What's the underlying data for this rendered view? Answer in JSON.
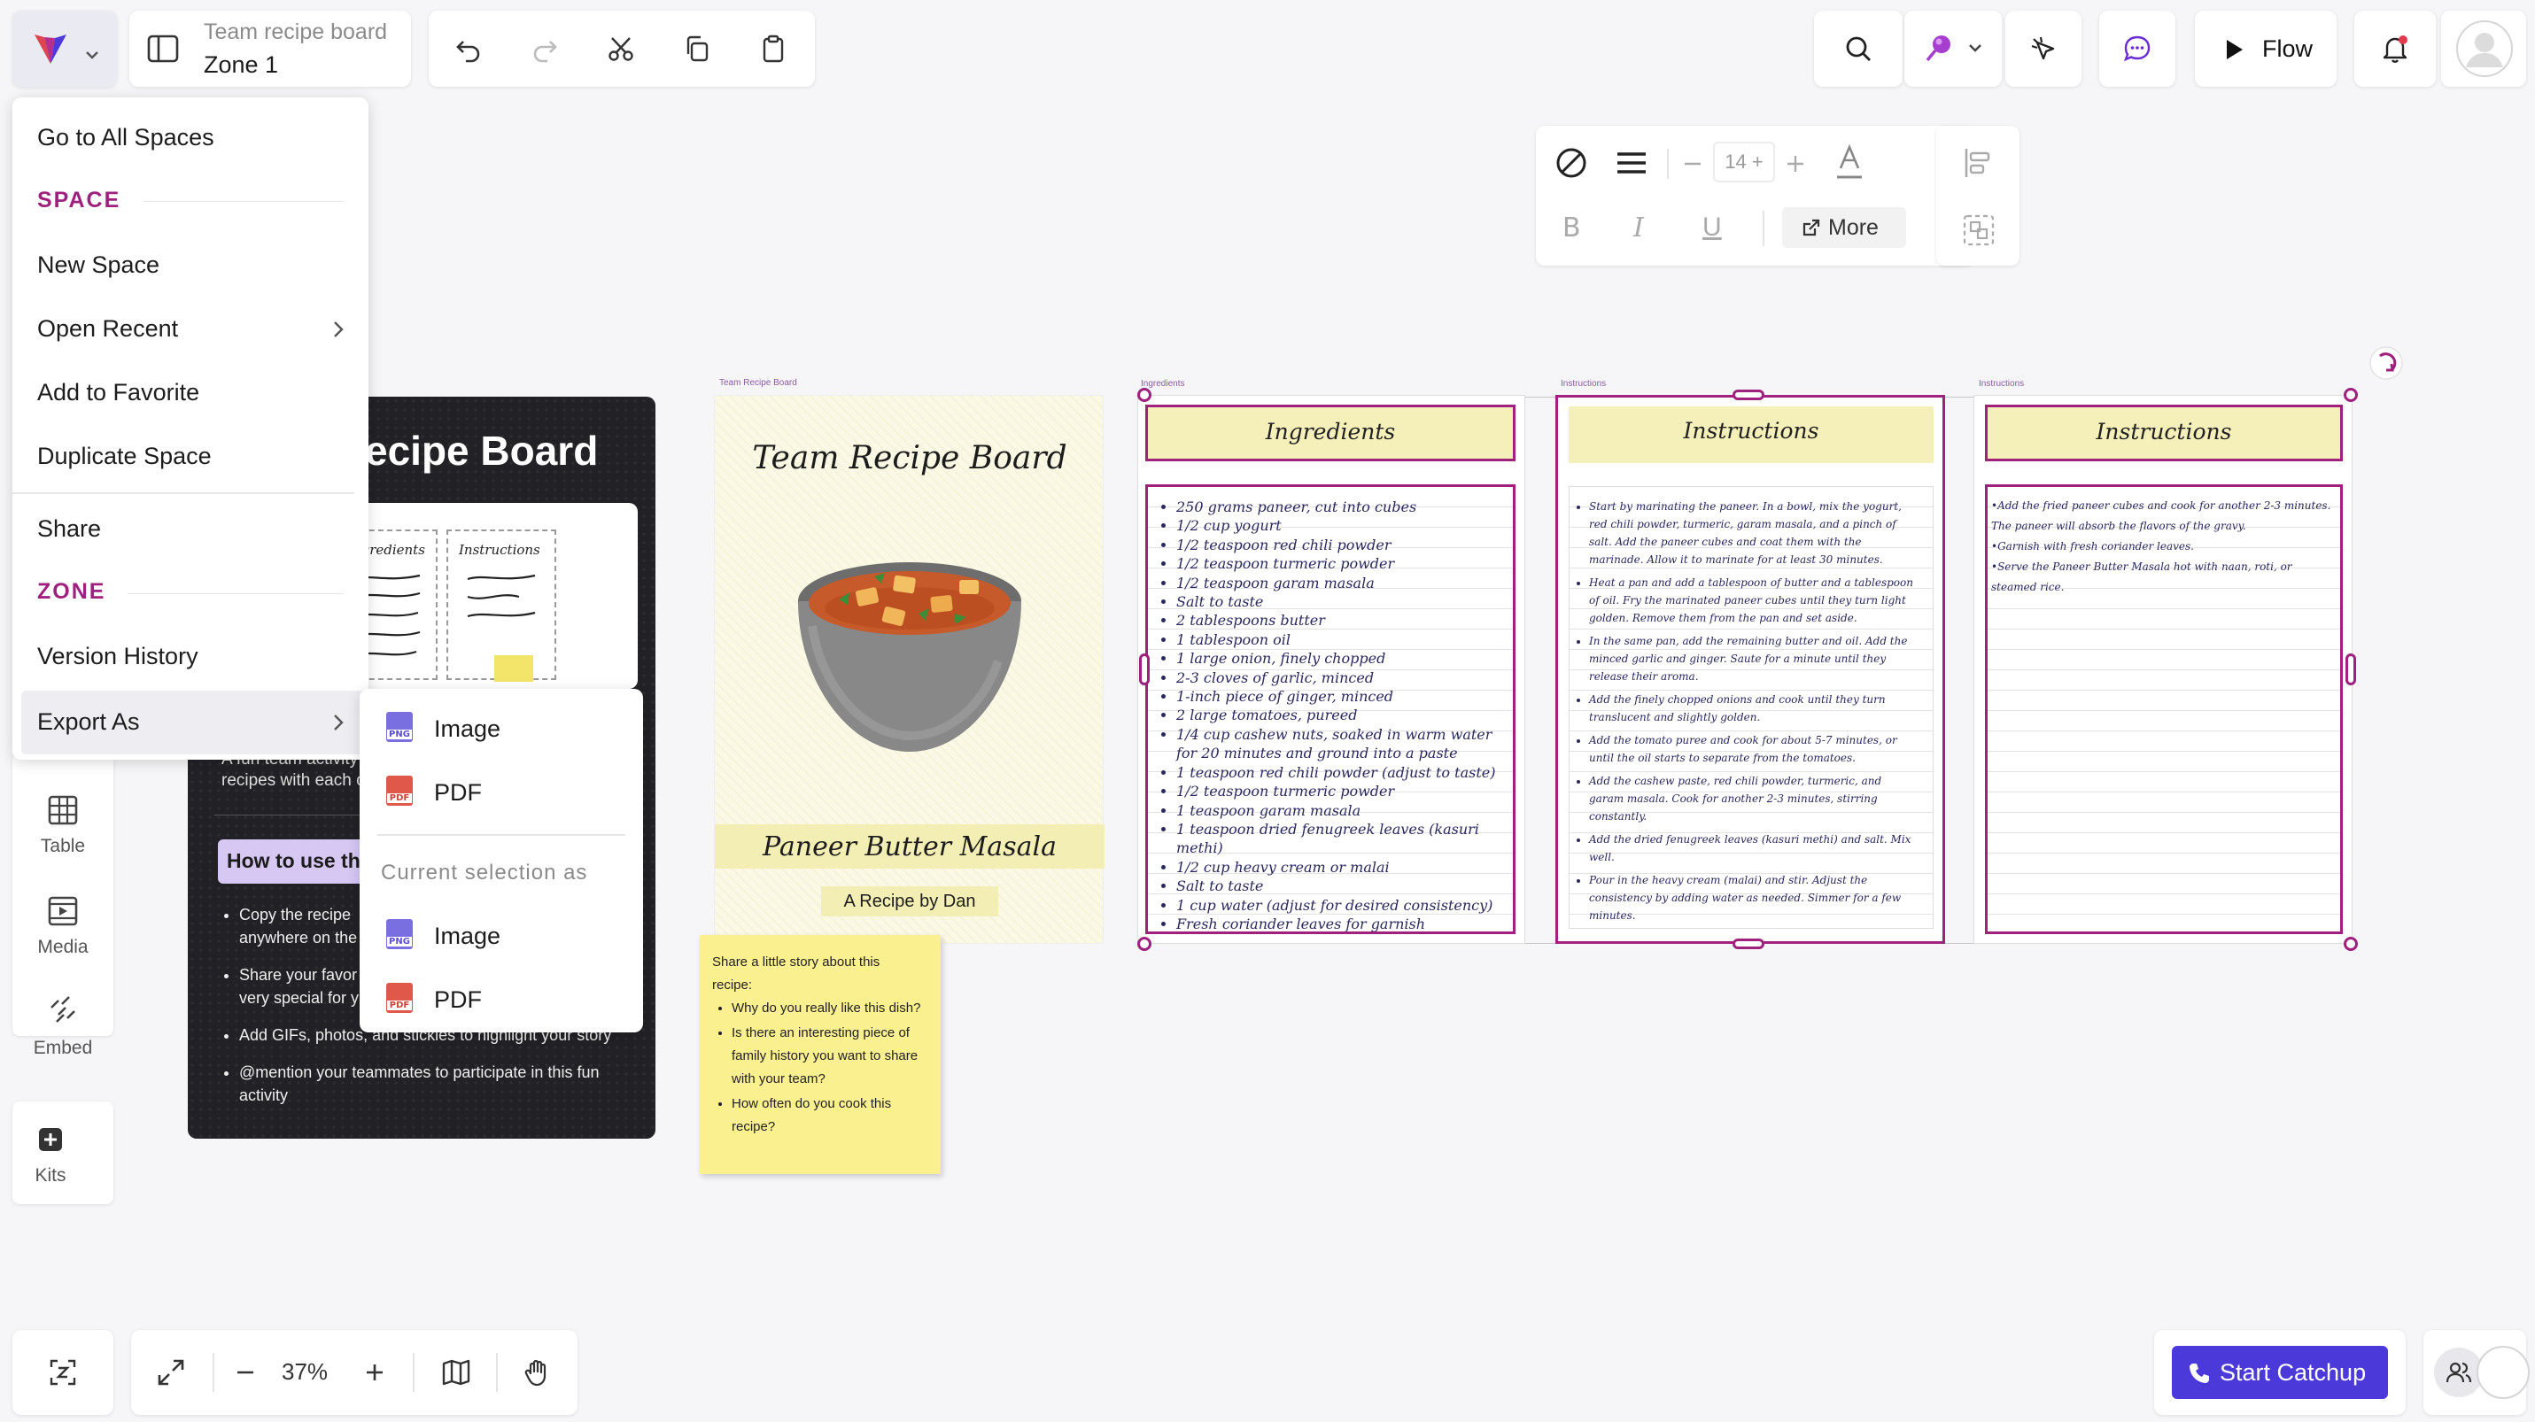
{
  "header": {
    "board_title": "Team recipe board",
    "zone_name": "Zone 1",
    "flow_label": "Flow"
  },
  "menu": {
    "go_to_all": "Go to All Spaces",
    "space_heading": "SPACE",
    "new_space": "New Space",
    "open_recent": "Open Recent",
    "add_favorite": "Add to Favorite",
    "duplicate_space": "Duplicate Space",
    "share": "Share",
    "zone_heading": "ZONE",
    "version_history": "Version History",
    "export_as": "Export As"
  },
  "export_submenu": {
    "image": "Image",
    "pdf": "PDF",
    "current_selection_heading": "Current selection as",
    "selection_image": "Image",
    "selection_pdf": "PDF",
    "png_badge": "PNG",
    "pdf_badge": "PDF"
  },
  "format_toolbar": {
    "font_size": "14",
    "more_label": "More",
    "bold": "B",
    "italic": "I",
    "underline": "U"
  },
  "tools": {
    "table": "Table",
    "media": "Media",
    "embed": "Embed",
    "kits": "Kits"
  },
  "bottom_bar": {
    "zoom_level": "37%",
    "start_catchup": "Start Catchup"
  },
  "dark_card": {
    "title": "ecipe Board",
    "ingredients_thumb": "Ingredients",
    "instructions_thumb": "Instructions",
    "desc_line1": "A fun team activity",
    "desc_line2": "recipes with each o",
    "how_to_title": "How to use th",
    "bullets": [
      "Copy the recipe anywhere on the",
      "Share your favor very special for y",
      "Add GIFs, photos, and stickies to highlight your story",
      "@mention your teammates to participate in this fun activity"
    ]
  },
  "recipe_card": {
    "frame_label": "Team Recipe Board",
    "title": "Team Recipe Board",
    "dish": "Paneer Butter Masala",
    "author": "A Recipe by Dan"
  },
  "sticky": {
    "intro": "Share a little story about this recipe:",
    "questions": [
      "Why do you really like this dish?",
      "Is there an interesting piece of family history you want to share with your team?",
      "How often do you cook this recipe?"
    ]
  },
  "ingredients_panel": {
    "frame_label": "Ingredients",
    "title": "Ingredients",
    "items": [
      "250 grams paneer, cut into cubes",
      "1/2 cup yogurt",
      "1/2 teaspoon red chili powder",
      "1/2 teaspoon turmeric powder",
      "1/2 teaspoon garam masala",
      "Salt to taste",
      "2 tablespoons butter",
      "1 tablespoon oil",
      "1 large onion, finely chopped",
      "2-3 cloves of garlic, minced",
      "1-inch piece of ginger, minced",
      "2 large tomatoes, pureed",
      "1/4 cup cashew nuts, soaked in warm water for 20 minutes and ground into a paste",
      "1 teaspoon red chili powder (adjust to taste)",
      "1/2 teaspoon turmeric powder",
      "1 teaspoon garam masala",
      "1 teaspoon dried fenugreek leaves (kasuri methi)",
      "1/2 cup heavy cream or malai",
      "Salt to taste",
      "1 cup water (adjust for desired consistency)",
      "Fresh coriander leaves for garnish"
    ]
  },
  "instructions_panel_1": {
    "frame_label": "Instructions",
    "title": "Instructions",
    "steps": [
      "Start by marinating the paneer. In a bowl, mix the yogurt, red chili powder, turmeric, garam masala, and a pinch of salt. Add the paneer cubes and coat them with the marinade. Allow it to marinate for at least 30 minutes.",
      "Heat a pan and add a tablespoon of butter and a tablespoon of oil. Fry the marinated paneer cubes until they turn light golden. Remove them from the pan and set aside.",
      "In the same pan, add the remaining butter and oil. Add the minced garlic and ginger. Saute for a minute until they release their aroma.",
      "Add the finely chopped onions and cook until they turn translucent and slightly golden.",
      "Add the tomato puree and cook for about 5-7 minutes, or until the oil starts to separate from the tomatoes.",
      "Add the cashew paste, red chili powder, turmeric, and garam masala. Cook for another 2-3 minutes, stirring constantly.",
      "Add the dried fenugreek leaves (kasuri methi) and salt. Mix well.",
      "Pour in the heavy cream (malai) and stir. Adjust the consistency by adding water as needed. Simmer for a few minutes."
    ]
  },
  "instructions_panel_2": {
    "frame_label": "Instructions",
    "title": "Instructions",
    "steps": [
      "•Add the fried paneer cubes and cook for another 2-3 minutes. The paneer will absorb the flavors of the gravy.",
      "•Garnish with fresh coriander leaves.",
      "•Serve the Paneer Butter Masala hot with naan, roti, or steamed rice."
    ]
  },
  "colors": {
    "accent": "#a0207e",
    "primary_button": "#4b3ad9",
    "panel_title_bg": "#f5f0ba",
    "sticky_bg": "#fbf08f",
    "dark_card_bg": "#222226"
  }
}
